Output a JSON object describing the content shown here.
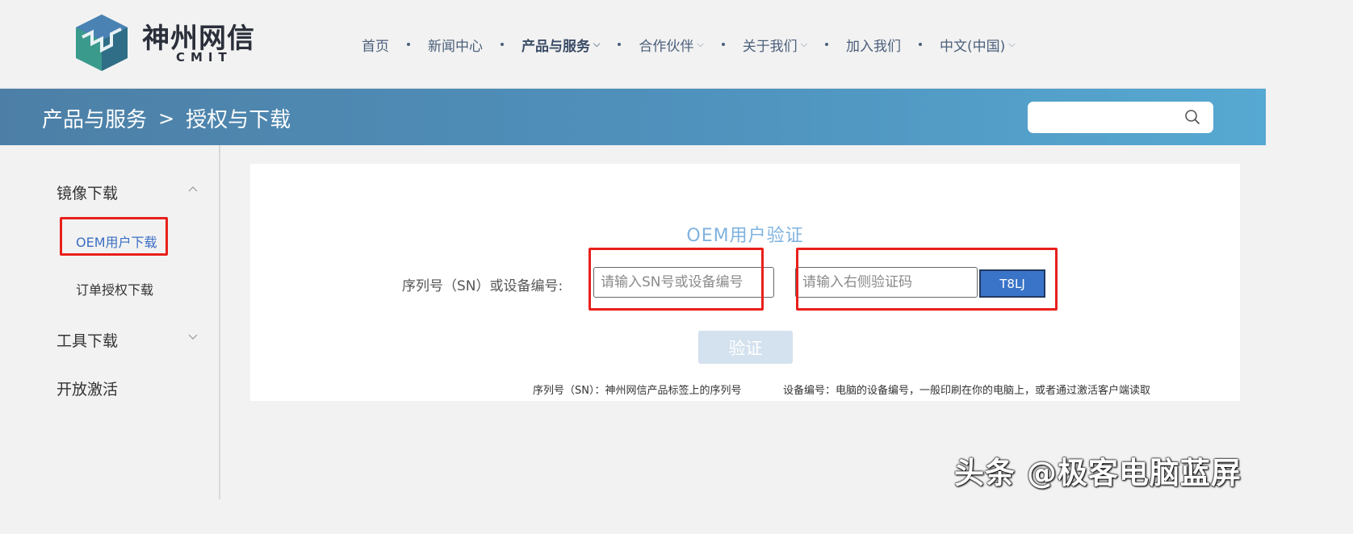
{
  "header": {
    "logo_name": "神州网信",
    "logo_sub": "CMIT",
    "nav": [
      {
        "label": "首页",
        "active": false,
        "dropdown": false
      },
      {
        "label": "新闻中心",
        "active": false,
        "dropdown": false
      },
      {
        "label": "产品与服务",
        "active": true,
        "dropdown": true
      },
      {
        "label": "合作伙伴",
        "active": false,
        "dropdown": true
      },
      {
        "label": "关于我们",
        "active": false,
        "dropdown": true
      },
      {
        "label": "加入我们",
        "active": false,
        "dropdown": false
      },
      {
        "label": "中文(中国)",
        "active": false,
        "dropdown": true
      }
    ]
  },
  "banner": {
    "crumb_parent": "产品与服务",
    "crumb_sep": ">",
    "crumb_current": "授权与下载",
    "search_placeholder": ""
  },
  "sidebar": {
    "group1": "镜像下载",
    "sub1": "OEM用户下载",
    "sub2": "订单授权下载",
    "group2": "工具下载",
    "group3": "开放激活"
  },
  "form": {
    "title": "OEM用户验证",
    "sn_label": "序列号（SN）或设备编号:",
    "sn_placeholder": "请输入SN号或设备编号",
    "code_placeholder": "请输入右侧验证码",
    "captcha": "T8LJ",
    "verify_label": "验证",
    "help_sn": "序列号（SN）：神州网信产品标签上的序列号",
    "help_device": "设备编号：电脑的设备编号，一般印刷在你的电脑上，或者通过激活客户端读取"
  },
  "watermark": "头条 @极客电脑蓝屏",
  "colors": {
    "accent": "#3a74c8",
    "highlight_box": "#e8201c",
    "banner_start": "#4d7fa6",
    "banner_end": "#56a9d2"
  }
}
